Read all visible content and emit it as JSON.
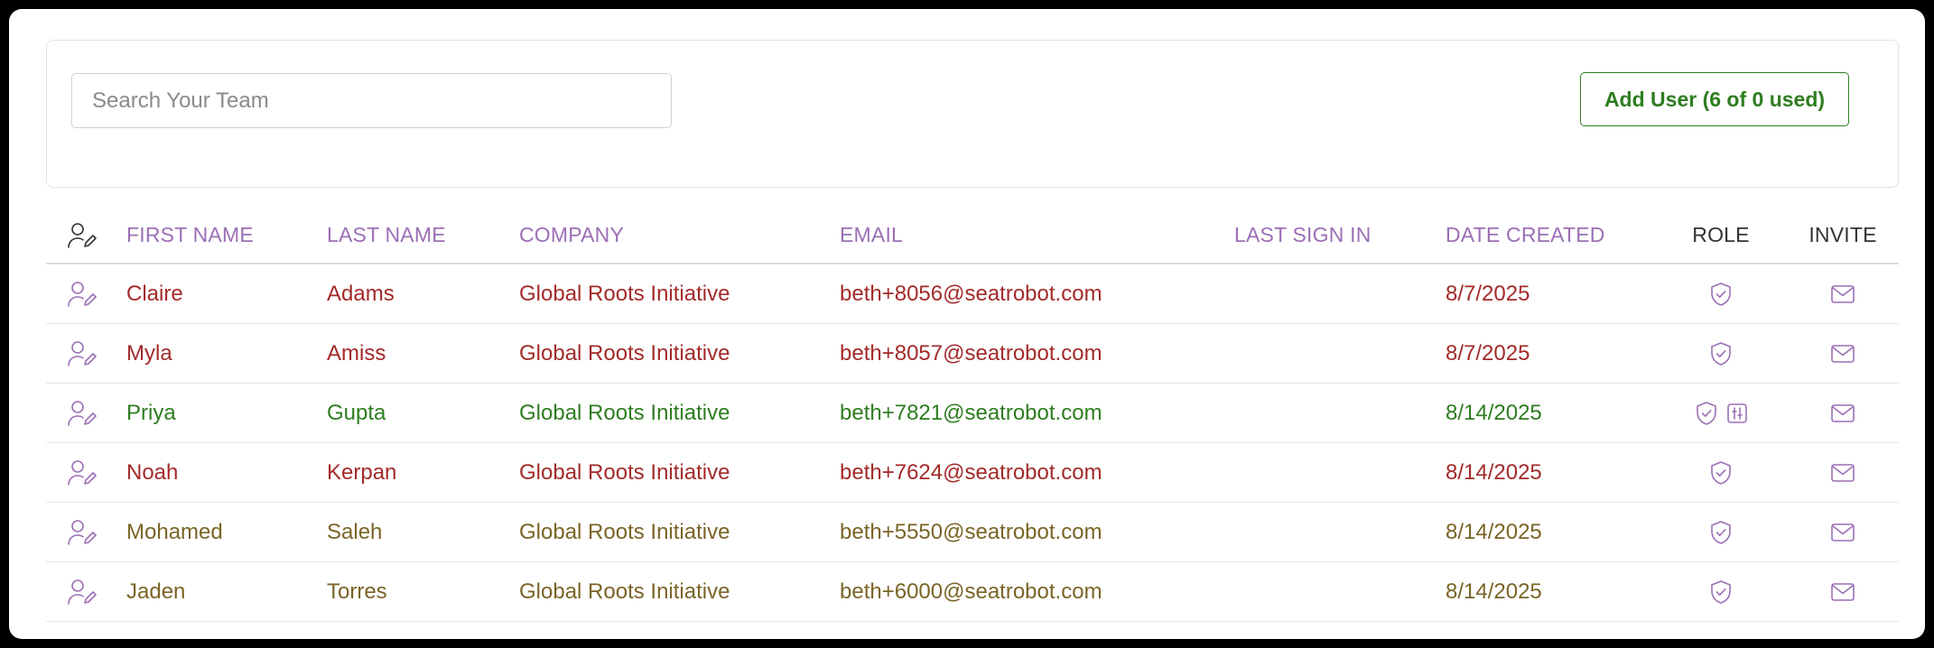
{
  "search": {
    "placeholder": "Search Your Team"
  },
  "toolbar": {
    "add_user_label": "Add User (6 of 0 used)"
  },
  "colors": {
    "header_purple": "#9b6fb5",
    "icon_purple": "#9b6fb5",
    "red_row": "#a32a2a",
    "green_row": "#2e7d20",
    "olive_row": "#7a6426",
    "button_green": "#2e7d20"
  },
  "table": {
    "header_icon": "user-edit-icon",
    "columns": [
      "FIRST NAME",
      "LAST NAME",
      "COMPANY",
      "EMAIL",
      "LAST SIGN IN",
      "DATE CREATED",
      "ROLE",
      "INVITE"
    ],
    "rows": [
      {
        "first": "Claire",
        "last": "Adams",
        "company": "Global Roots Initiative",
        "email": "beth+8056@seatrobot.com",
        "last_sign_in": "",
        "created": "8/7/2025",
        "color": "#a32a2a",
        "role_icons": [
          "shield-check-icon"
        ],
        "invite_icon": "envelope-icon"
      },
      {
        "first": "Myla",
        "last": "Amiss",
        "company": "Global Roots Initiative",
        "email": "beth+8057@seatrobot.com",
        "last_sign_in": "",
        "created": "8/7/2025",
        "color": "#a32a2a",
        "role_icons": [
          "shield-check-icon"
        ],
        "invite_icon": "envelope-icon"
      },
      {
        "first": "Priya",
        "last": "Gupta",
        "company": "Global Roots Initiative",
        "email": "beth+7821@seatrobot.com",
        "last_sign_in": "",
        "created": "8/14/2025",
        "color": "#2e7d20",
        "role_icons": [
          "shield-check-icon",
          "sliders-icon"
        ],
        "invite_icon": "envelope-icon"
      },
      {
        "first": "Noah",
        "last": "Kerpan",
        "company": "Global Roots Initiative",
        "email": "beth+7624@seatrobot.com",
        "last_sign_in": "",
        "created": "8/14/2025",
        "color": "#a32a2a",
        "role_icons": [
          "shield-check-icon"
        ],
        "invite_icon": "envelope-icon"
      },
      {
        "first": "Mohamed",
        "last": "Saleh",
        "company": "Global Roots Initiative",
        "email": "beth+5550@seatrobot.com",
        "last_sign_in": "",
        "created": "8/14/2025",
        "color": "#7a6426",
        "role_icons": [
          "shield-check-icon"
        ],
        "invite_icon": "envelope-icon"
      },
      {
        "first": "Jaden",
        "last": "Torres",
        "company": "Global Roots Initiative",
        "email": "beth+6000@seatrobot.com",
        "last_sign_in": "",
        "created": "8/14/2025",
        "color": "#7a6426",
        "role_icons": [
          "shield-check-icon"
        ],
        "invite_icon": "envelope-icon"
      }
    ]
  }
}
